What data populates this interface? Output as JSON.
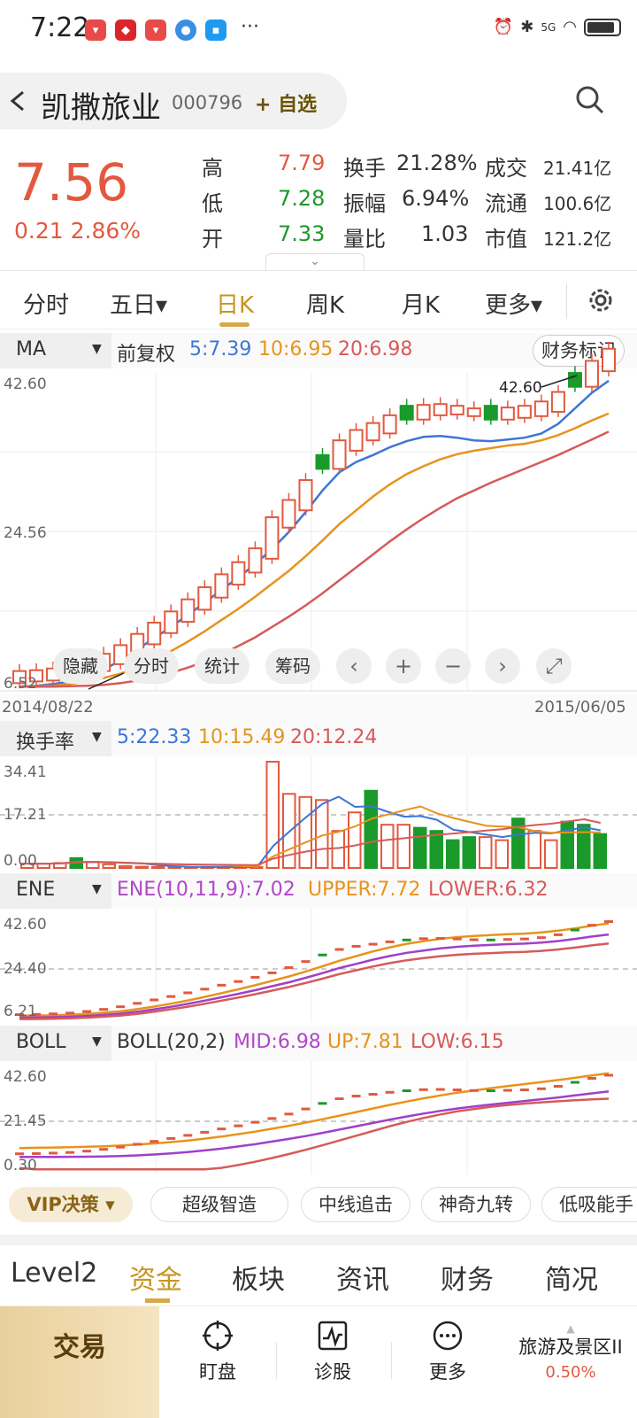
{
  "status_bar": {
    "time": "7:22",
    "more": "···",
    "network": "5G"
  },
  "header": {
    "back_icon": "chevron-left-icon",
    "name": "凯撒旅业",
    "code": "000796",
    "watch_label": "+ 自选"
  },
  "quote": {
    "price": "7.56",
    "change": "0.21",
    "change_pct": "2.86%",
    "high_label": "高",
    "high": "7.79",
    "low_label": "低",
    "low": "7.28",
    "open_label": "开",
    "open": "7.33",
    "turnover_label": "换手",
    "turnover": "21.28%",
    "amplitude_label": "振幅",
    "amplitude": "6.94%",
    "volratio_label": "量比",
    "volratio": "1.03",
    "volume_label": "成交",
    "volume": "21.41亿",
    "float_label": "流通",
    "float_cap": "100.6亿",
    "mcap_label": "市值",
    "mcap": "121.2亿"
  },
  "tabs": [
    {
      "label": "分时"
    },
    {
      "label": "五日▾"
    },
    {
      "label": "日K"
    },
    {
      "label": "周K"
    },
    {
      "label": "月K"
    },
    {
      "label": "更多▾"
    }
  ],
  "ma_bar": {
    "name": "MA",
    "adjust": "前复权",
    "ma5": "5:7.39",
    "ma10": "10:6.95",
    "ma20": "20:6.98",
    "fin_button": "财务标记"
  },
  "kline": {
    "y_top": "42.60",
    "y_mid": "24.56",
    "y_bot": "6.52",
    "max_note": "42.60",
    "date_start": "2014/08/22",
    "date_end": "2015/06/05"
  },
  "overlay": {
    "hide": "隐藏",
    "intraday": "分时",
    "stats": "统计",
    "chips": "筹码"
  },
  "turnover_bar": {
    "name": "换手率",
    "v5": "5:22.33",
    "v10": "10:15.49",
    "v20": "20:12.24",
    "y_top": "34.41",
    "y_mid": "17.21",
    "y_bot": "0.00"
  },
  "ene_bar": {
    "name": "ENE",
    "params": "ENE(10,11,9)",
    "value": ":7.02",
    "upper": "UPPER:7.72",
    "lower": "LOWER:6.32",
    "y_top": "42.60",
    "y_mid": "24.40",
    "y_bot": "6.21"
  },
  "boll_bar": {
    "name": "BOLL",
    "params": "BOLL(20,2)",
    "mid": "MID:6.98",
    "up": "UP:7.81",
    "low": "LOW:6.15",
    "y_top": "42.60",
    "y_mid": "21.45",
    "y_bot": "0.30"
  },
  "features": {
    "vip": "VIP决策 ▾",
    "items": [
      "超级智造",
      "中线追击",
      "神奇九转",
      "低吸能手"
    ]
  },
  "bottom_tabs": [
    "Level2",
    "资金",
    "板块",
    "资讯",
    "财务",
    "简况"
  ],
  "nav": {
    "trade": "交易",
    "watch": "盯盘",
    "diagnose": "诊股",
    "more": "更多",
    "sector_name": "旅游及景区II",
    "sector_pct": "0.50%"
  },
  "colors": {
    "up": "#e2593f",
    "down": "#1a9a2a",
    "accent": "#c8951f",
    "ma5": "#3d76d6",
    "ma10": "#e8931c",
    "ma20": "#d65a5a"
  },
  "chart_data": [
    {
      "type": "candlestick",
      "title": "日K",
      "ylim": [
        6.52,
        42.6
      ],
      "series": [
        {
          "name": "5",
          "values": [
            6.6,
            6.7,
            6.9,
            7.2,
            7.8,
            8.6,
            9.6,
            10.9,
            12.2,
            13.5,
            14.9,
            16.3,
            17.8,
            19.2,
            20.8,
            22.5,
            24.5,
            26.8,
            29.3,
            31.4,
            32.6,
            33.4,
            34.3,
            35.0,
            35.5,
            35.6,
            35.4,
            35.1,
            35.0,
            35.2,
            35.4,
            35.9,
            37.0,
            38.8,
            40.6,
            42.0
          ]
        },
        {
          "name": "10",
          "values": [
            6.6,
            6.65,
            6.7,
            6.9,
            7.2,
            7.6,
            8.1,
            8.8,
            9.7,
            10.7,
            11.8,
            13.0,
            14.3,
            15.6,
            17.0,
            18.5,
            20.0,
            21.7,
            23.5,
            25.4,
            27.0,
            28.6,
            30.0,
            31.2,
            32.1,
            32.9,
            33.5,
            33.9,
            34.2,
            34.5,
            34.7,
            35.1,
            35.7,
            36.5,
            37.4,
            38.2
          ]
        },
        {
          "name": "20",
          "values": [
            6.6,
            6.6,
            6.6,
            6.65,
            6.7,
            6.8,
            7.0,
            7.3,
            7.7,
            8.2,
            8.8,
            9.5,
            10.3,
            11.3,
            12.3,
            13.5,
            14.7,
            16.0,
            17.4,
            18.9,
            20.4,
            21.9,
            23.4,
            24.8,
            26.1,
            27.3,
            28.4,
            29.3,
            30.2,
            31.0,
            31.8,
            32.6,
            33.4,
            34.3,
            35.2,
            36.1
          ]
        }
      ]
    },
    {
      "type": "bar",
      "title": "换手率",
      "ylim": [
        0,
        34.41
      ],
      "values": [
        1.4,
        1.4,
        1.6,
        3.2,
        2.0,
        1.2,
        0.6,
        0.4,
        0.3,
        0.3,
        0.3,
        0.3,
        0.3,
        0.3,
        0.3,
        34.41,
        24.0,
        23.0,
        22.0,
        12.0,
        18.0,
        25.0,
        14.0,
        14.0,
        13.0,
        12.0,
        9.0,
        10.0,
        10.0,
        9.0,
        16.0,
        12.0,
        9.0,
        15.0,
        14.0,
        11.0
      ]
    }
  ]
}
